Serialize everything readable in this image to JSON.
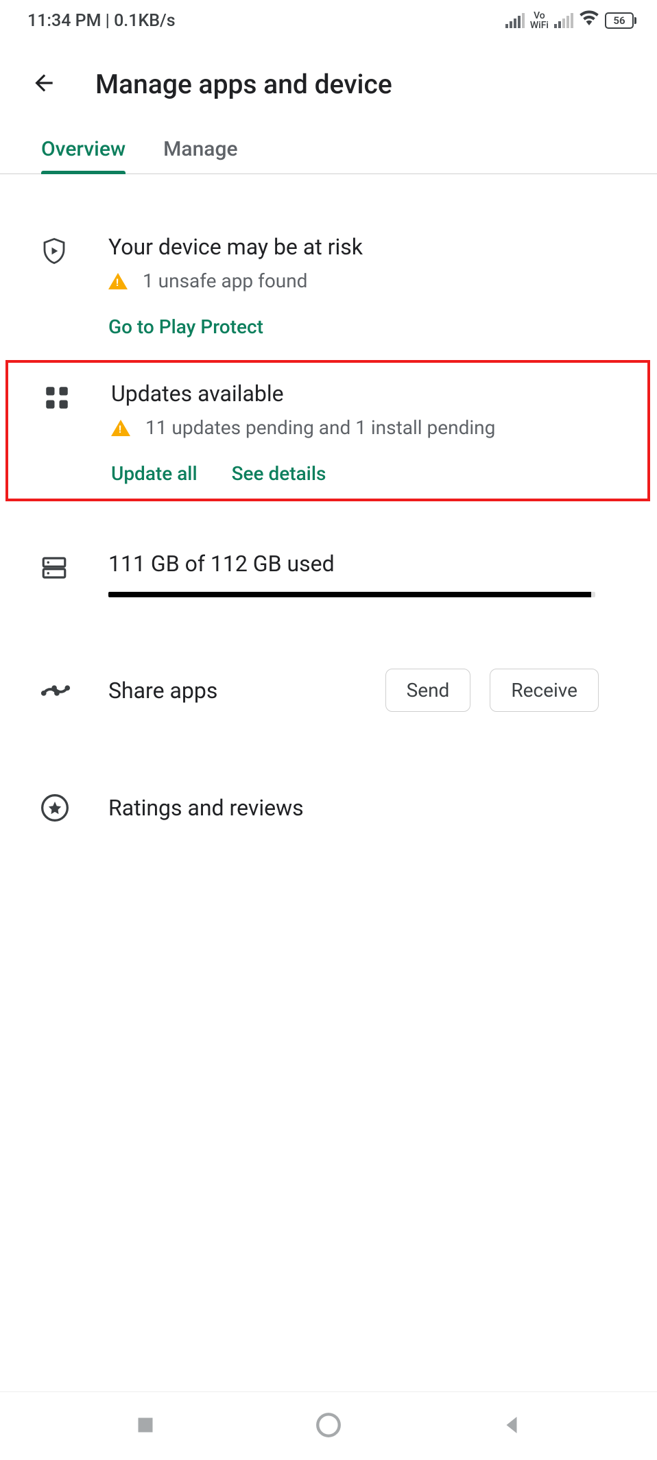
{
  "status_bar": {
    "time_kb": "11:34 PM | 0.1KB/s",
    "battery": "56"
  },
  "header": {
    "title": "Manage apps and device"
  },
  "tabs": {
    "overview": "Overview",
    "manage": "Manage"
  },
  "play_protect": {
    "title": "Your device may be at risk",
    "subtitle": "1 unsafe app found",
    "action": "Go to Play Protect"
  },
  "updates": {
    "title": "Updates available",
    "subtitle": "11 updates pending and 1 install pending",
    "update_all": "Update all",
    "see_details": "See details"
  },
  "storage": {
    "text": "111 GB of 112 GB used",
    "percent": 99.1
  },
  "share": {
    "label": "Share apps",
    "send": "Send",
    "receive": "Receive"
  },
  "ratings": {
    "label": "Ratings and reviews"
  }
}
